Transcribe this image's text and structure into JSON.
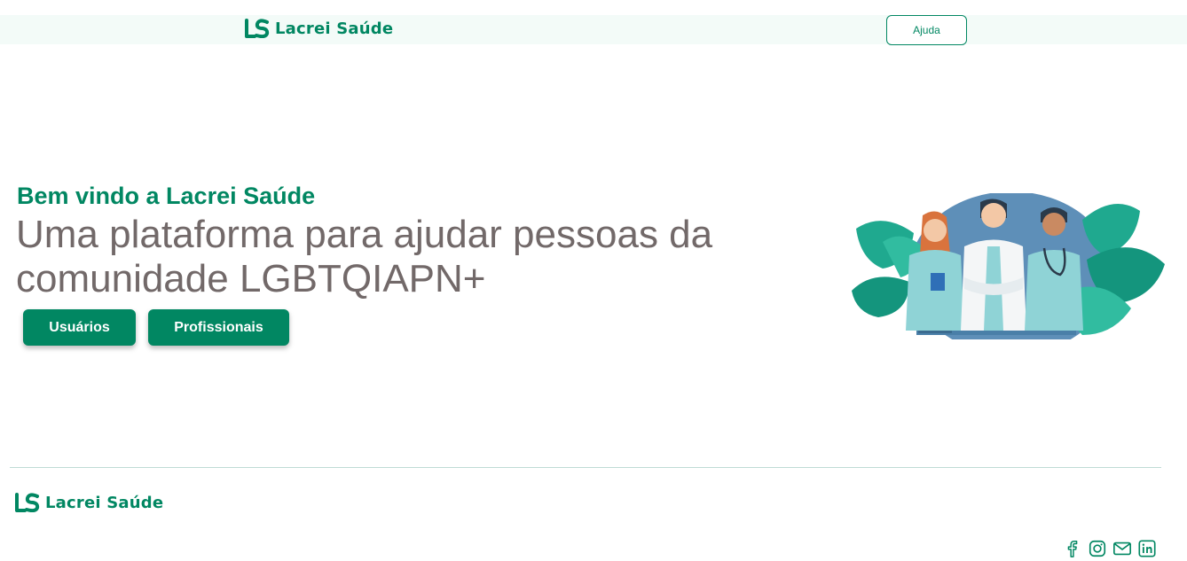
{
  "header": {
    "brand": "Lacrei Saúde",
    "help_label": "Ajuda"
  },
  "hero": {
    "welcome": "Bem vindo a Lacrei Saúde",
    "headline": "Uma plataforma para ajudar pessoas da comunidade LGBTQIAPN+",
    "buttons": {
      "users": "Usuários",
      "professionals": "Profissionais"
    }
  },
  "footer": {
    "brand": "Lacrei Saúde",
    "socials": [
      "facebook-icon",
      "instagram-icon",
      "mail-icon",
      "linkedin-icon"
    ]
  },
  "colors": {
    "brand_green": "#018762",
    "headline_gray": "#726969",
    "header_bg": "#f3fbf8"
  }
}
